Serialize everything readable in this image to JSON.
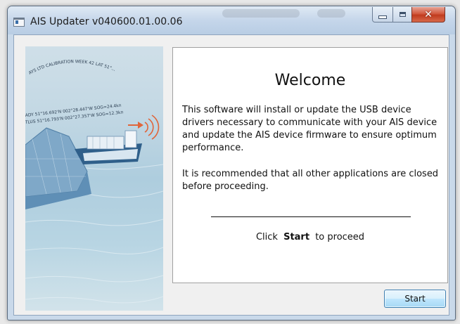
{
  "window": {
    "title": "AIS Updater v040600.01.00.06",
    "controls": {
      "minimize": "minimize",
      "maximize": "maximize",
      "close": "✕"
    }
  },
  "illustration": {
    "arc_text": "AYS LTD CALIBRATION  WEEK 42 LAT 51°...",
    "vessel_line_1": "ADY 51°16.692'N 002°28.447'W SOG=24.4kn",
    "vessel_line_2": "TLUS 51°16.793'N 002°27.357'W SOG=12.3kn",
    "icons": [
      "ship-icon",
      "radio-waves-icon",
      "direction-arrow-icon"
    ]
  },
  "content": {
    "heading": "Welcome",
    "paragraph_1": "This software will install or update the USB device drivers necessary to communicate with your AIS device and update the AIS device firmware to ensure optimum performance.",
    "paragraph_2": "It is recommended that all other applications are closed before proceeding.",
    "cta_prefix": "Click",
    "cta_bold": "Start",
    "cta_suffix": "to proceed"
  },
  "buttons": {
    "start": "Start"
  },
  "colors": {
    "accent": "#3c7fb1",
    "close": "#c03b1e",
    "arrow": "#e0653a"
  }
}
